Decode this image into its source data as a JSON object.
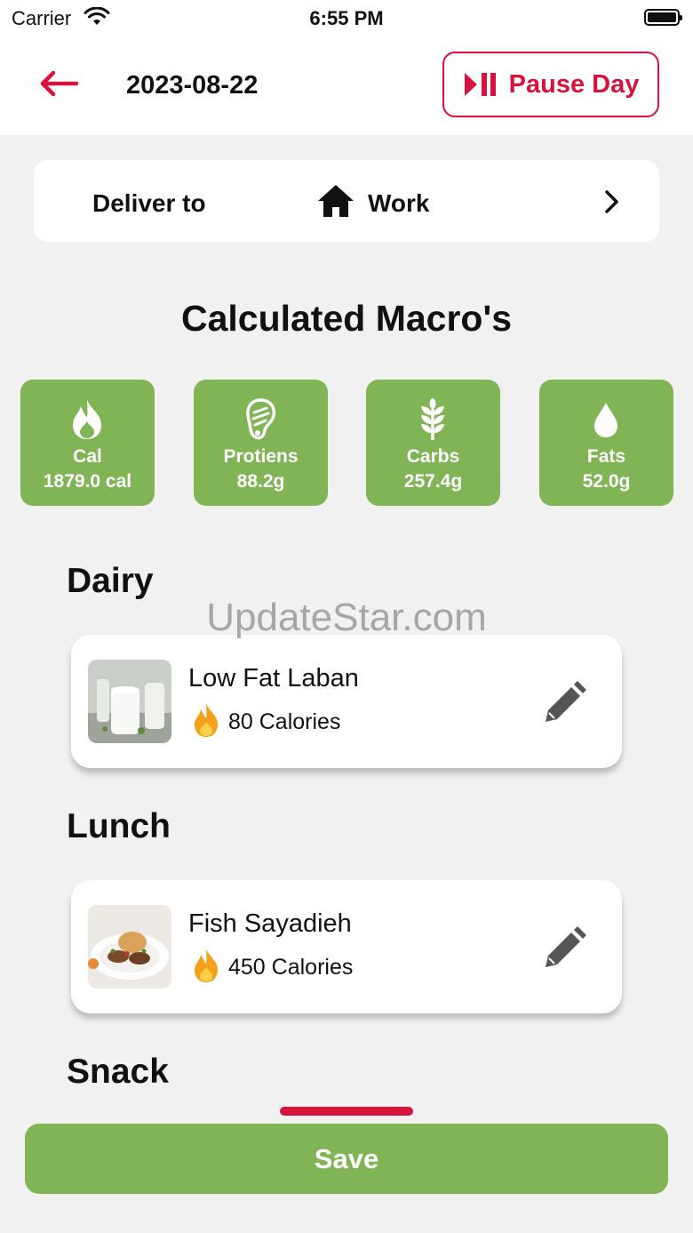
{
  "status_bar": {
    "carrier": "Carrier",
    "time": "6:55 PM"
  },
  "header": {
    "date": "2023-08-22",
    "pause_label": "Pause Day"
  },
  "delivery": {
    "label": "Deliver to",
    "location": "Work"
  },
  "macros": {
    "title": "Calculated Macro's",
    "items": [
      {
        "icon": "flame-icon",
        "label": "Cal",
        "value": "1879.0 cal"
      },
      {
        "icon": "meat-icon",
        "label": "Protiens",
        "value": "88.2g"
      },
      {
        "icon": "wheat-icon",
        "label": "Carbs",
        "value": "257.4g"
      },
      {
        "icon": "drop-icon",
        "label": "Fats",
        "value": "52.0g"
      }
    ]
  },
  "watermark": "UpdateStar.com",
  "sections": [
    {
      "title": "Dairy",
      "meals": [
        {
          "name": "Low Fat Laban",
          "calories": "80 Calories"
        }
      ]
    },
    {
      "title": "Lunch",
      "meals": [
        {
          "name": "Fish Sayadieh",
          "calories": "450 Calories"
        }
      ]
    },
    {
      "title": "Snack",
      "meals": []
    }
  ],
  "footer": {
    "save_label": "Save"
  },
  "colors": {
    "accent_red": "#d7133d",
    "accent_green": "#81b454",
    "background": "#f1f1f1"
  }
}
